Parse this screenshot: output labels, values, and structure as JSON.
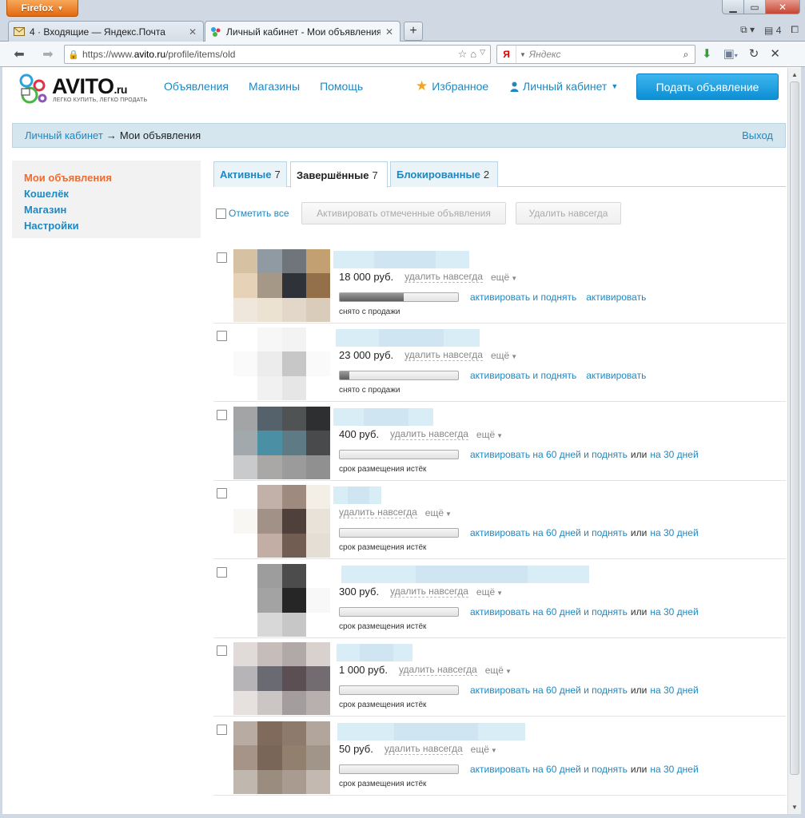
{
  "browser": {
    "app_button": "Firefox",
    "tabs": [
      {
        "title": "4 · Входящие — Яндекс.Почта",
        "active": false
      },
      {
        "title": "Личный кабинет - Мои объявления ...",
        "active": true
      }
    ],
    "tab_count": "4",
    "url_prefix": "https://www.",
    "url_host": "avito.ru",
    "url_path": "/profile/items/old",
    "search_placeholder": "Яндекс",
    "search_engine_glyph": "Я"
  },
  "header": {
    "logo_text": "AVITO",
    "logo_suffix": ".ru",
    "tagline": "ЛЕГКО КУПИТЬ, ЛЕГКО ПРОДАТЬ",
    "nav": [
      "Объявления",
      "Магазины",
      "Помощь"
    ],
    "favorites": "Избранное",
    "cabinet": "Личный кабинет",
    "post_button": "Подать объявление"
  },
  "breadcrumb": {
    "root": "Личный кабинет",
    "arrow": "→",
    "current": "Мои объявления",
    "logout": "Выход"
  },
  "sidebar": {
    "items": [
      {
        "label": "Мои объявления",
        "active": true
      },
      {
        "label": "Кошелёк",
        "active": false
      },
      {
        "label": "Магазин",
        "active": false
      },
      {
        "label": "Настройки",
        "active": false
      }
    ]
  },
  "tabs": [
    {
      "label": "Активные",
      "count": "7",
      "active": false
    },
    {
      "label": "Завершённые",
      "count": "7",
      "active": true
    },
    {
      "label": "Блокированные",
      "count": "2",
      "active": false
    }
  ],
  "toolbar": {
    "mark_all": "Отметить все",
    "activate_selected": "Активировать отмеченные объявления",
    "delete_forever": "Удалить навсегда"
  },
  "listings": [
    {
      "price": "18 000 руб.",
      "delete": "удалить навсегда",
      "more": "ещё",
      "progress": 0.54,
      "actions": [
        "активировать и поднять",
        "активировать"
      ],
      "joiner": "",
      "status": "снято с продажи"
    },
    {
      "price": "23 000 руб.",
      "delete": "удалить навсегда",
      "more": "ещё",
      "progress": 0.08,
      "actions": [
        "активировать и поднять",
        "активировать"
      ],
      "joiner": "",
      "status": "снято с продажи"
    },
    {
      "price": "400 руб.",
      "delete": "удалить навсегда",
      "more": "ещё",
      "progress": 0,
      "actions": [
        "активировать на 60 дней и поднять",
        "на 30 дней"
      ],
      "joiner": "или",
      "status": "срок размещения истёк"
    },
    {
      "price": "",
      "delete": "удалить навсегда",
      "more": "ещё",
      "progress": 0,
      "actions": [
        "активировать на 60 дней и поднять",
        "на 30 дней"
      ],
      "joiner": "или",
      "status": "срок размещения истёк"
    },
    {
      "price": "300 руб.",
      "delete": "удалить навсегда",
      "more": "ещё",
      "progress": 0,
      "actions": [
        "активировать на 60 дней и поднять",
        "на 30 дней"
      ],
      "joiner": "или",
      "status": "срок размещения истёк"
    },
    {
      "price": "1 000 руб.",
      "delete": "удалить навсегда",
      "more": "ещё",
      "progress": 0,
      "actions": [
        "активировать на 60 дней и поднять",
        "на 30 дней"
      ],
      "joiner": "или",
      "status": "срок размещения истёк"
    },
    {
      "price": "50 руб.",
      "delete": "удалить навсегда",
      "more": "ещё",
      "progress": 0,
      "actions": [
        "активировать на 60 дней и поднять",
        "на 30 дней"
      ],
      "joiner": "или",
      "status": "срок размещения истёк"
    }
  ],
  "colors": {
    "link": "#1e88c2",
    "active_sidebar": "#f06b2e",
    "post_button": "#1a9be0",
    "breadcrumb_bg": "#d5e6ef",
    "favorite_star": "#f2a51c"
  }
}
